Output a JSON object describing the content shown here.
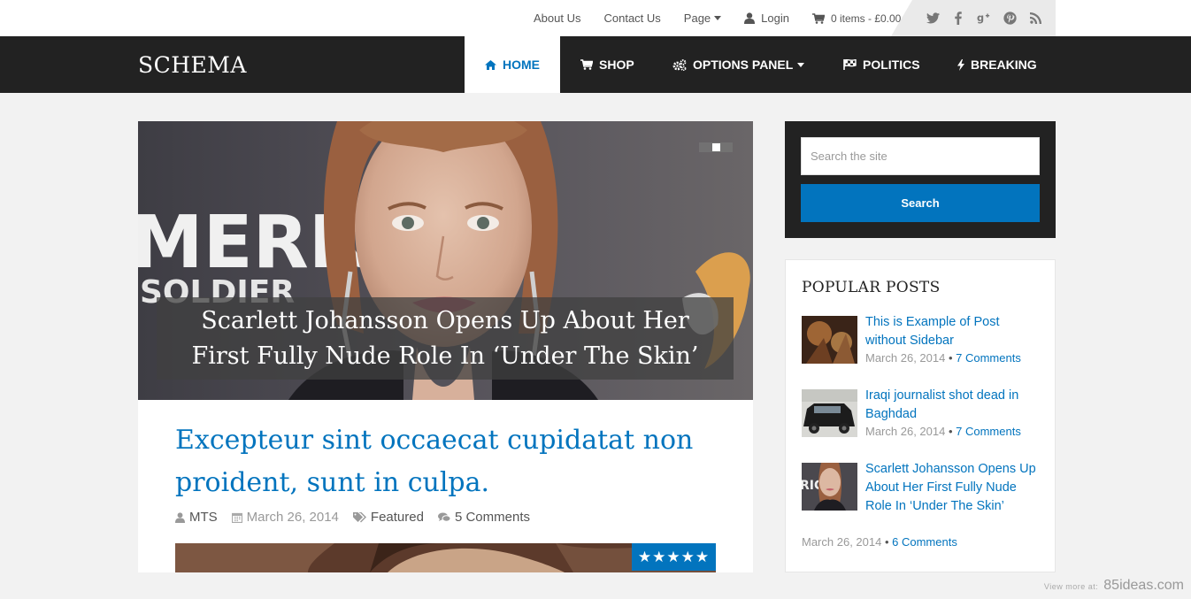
{
  "topbar": {
    "links": [
      {
        "label": "About Us"
      },
      {
        "label": "Contact Us"
      },
      {
        "label": "Page"
      },
      {
        "label": "Login"
      }
    ],
    "cart": "0 items - £0.00",
    "social_icons": [
      "twitter-icon",
      "facebook-icon",
      "google-plus-icon",
      "pinterest-icon",
      "rss-icon"
    ]
  },
  "nav": {
    "logo": "SCHEMA",
    "items": [
      {
        "label": "HOME",
        "icon": "home-icon",
        "active": true
      },
      {
        "label": "SHOP",
        "icon": "cart-icon"
      },
      {
        "label": "OPTIONS PANEL",
        "icon": "cogs-icon"
      },
      {
        "label": "POLITICS",
        "icon": "flag-icon"
      },
      {
        "label": "BREAKING",
        "icon": "bolt-icon"
      }
    ]
  },
  "slider": {
    "caption": "Scarlett Johansson Opens Up About Her First Fully Nude Role In ‘Under The Skin’"
  },
  "post": {
    "title": "Excepteur sint occaecat cupidatat non proident, sunt in culpa.",
    "author": "MTS",
    "date": "March 26, 2014",
    "category": "Featured",
    "comments": "5 Comments",
    "rating_stars": 5
  },
  "search": {
    "placeholder": "Search the site",
    "button": "Search"
  },
  "popular": {
    "title": "POPULAR POSTS",
    "posts": [
      {
        "title": "This is Example of Post without Sidebar",
        "date": "March 26, 2014",
        "comments": "7 Comments"
      },
      {
        "title": "Iraqi journalist shot dead in Baghdad",
        "date": "March 26, 2014",
        "comments": "7 Comments"
      },
      {
        "title": "Scarlett Johansson Opens Up About Her First Fully Nude Role In ‘Under The Skin’",
        "date": "March 26, 2014",
        "comments": "6 Comments"
      }
    ]
  },
  "watermark": {
    "small": "View more at:",
    "large": "85ideas.com"
  },
  "colors": {
    "accent": "#0274be",
    "nav_bg": "#222222",
    "page_bg": "#f2f2f2"
  }
}
